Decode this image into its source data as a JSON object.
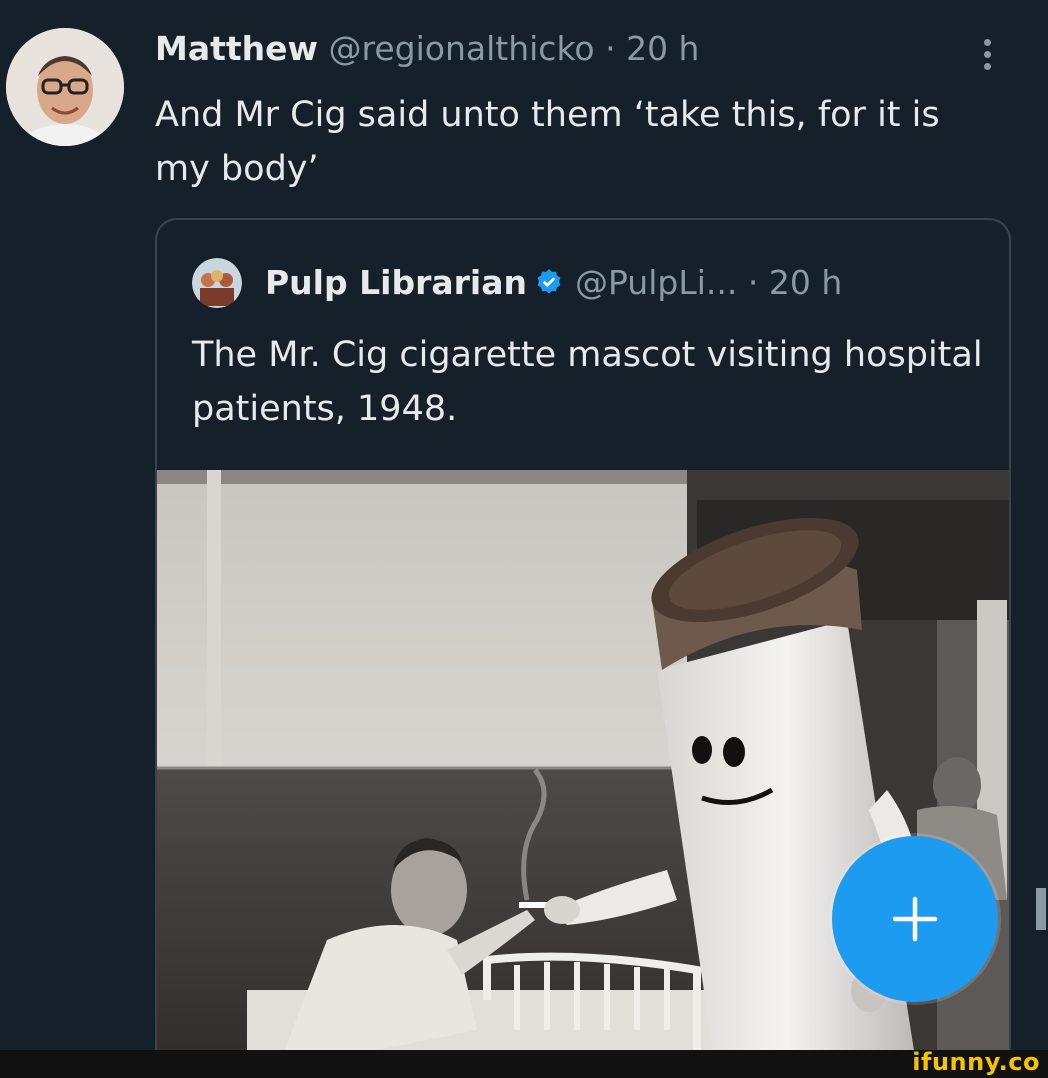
{
  "tweet": {
    "author_name": "Matthew",
    "handle": "@regionalthicko",
    "separator": "·",
    "time": "20 h",
    "text": "And Mr Cig said unto them ‘take this, for it is my body’",
    "avatar_icon": "profile-photo-icon",
    "more_icon": "more-vertical-icon"
  },
  "quote": {
    "author_name": "Pulp Librarian",
    "verified_icon": "verified-badge-icon",
    "handle": "@PulpLi...",
    "separator": "·",
    "time": "20 h",
    "text": "The Mr. Cig cigarette mascot visiting hospital patients, 1948."
  },
  "fab": {
    "icon": "plus-icon",
    "color": "#1d9bf0"
  },
  "watermark": {
    "text": "ifunny.co",
    "color": "#f4c400"
  },
  "colors": {
    "background": "#15202b",
    "text": "#e7e9ea",
    "secondary": "#8b98a5",
    "border": "#38444d"
  }
}
